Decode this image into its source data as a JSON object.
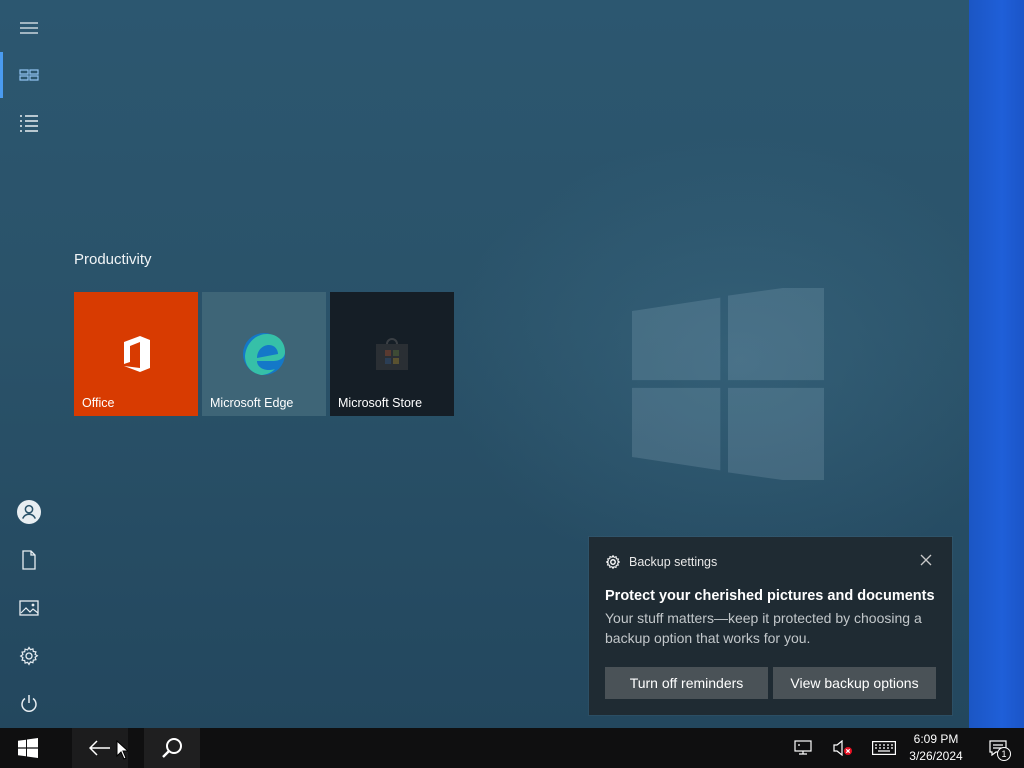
{
  "start_menu": {
    "group_title": "Productivity",
    "tiles": [
      {
        "label": "Office",
        "color": "#d83b01"
      },
      {
        "label": "Microsoft Edge",
        "color": "#3e6577"
      },
      {
        "label": "Microsoft Store",
        "color": "#151e26"
      }
    ],
    "rail_icons": [
      "hamburger-icon",
      "tiles-icon",
      "all-apps-list-icon",
      "user-icon",
      "documents-icon",
      "pictures-icon",
      "settings-icon",
      "power-icon"
    ]
  },
  "notification": {
    "app_name": "Backup settings",
    "title": "Protect your cherished pictures and documents",
    "body": "Your stuff matters—keep it protected by choosing a backup option that works for you.",
    "buttons": {
      "turn_off": "Turn off reminders",
      "view_options": "View backup options"
    }
  },
  "taskbar": {
    "time": "6:09 PM",
    "date": "3/26/2024",
    "notification_count": "1"
  },
  "colors": {
    "accent_blue": "#1f5fd8",
    "taskbar": "#0f0f10"
  }
}
